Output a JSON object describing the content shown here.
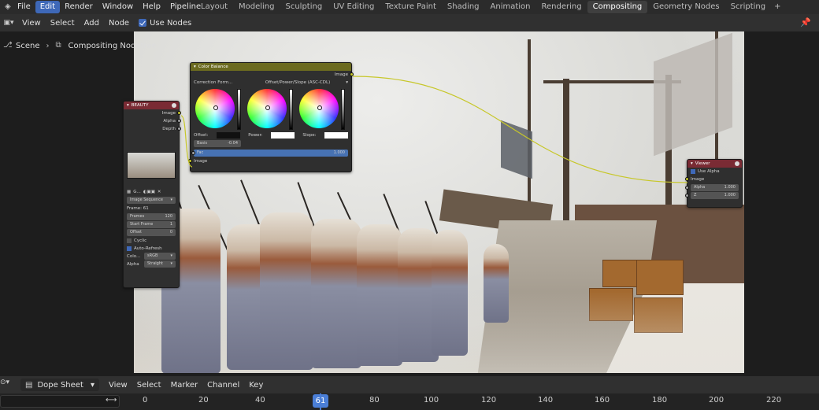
{
  "menu": [
    "File",
    "Edit",
    "Render",
    "Window",
    "Help",
    "Pipeline"
  ],
  "menu_active": "Edit",
  "workspaces": [
    "Layout",
    "Modeling",
    "Sculpting",
    "UV Editing",
    "Texture Paint",
    "Shading",
    "Animation",
    "Rendering",
    "Compositing",
    "Geometry Nodes",
    "Scripting"
  ],
  "workspace_active": "Compositing",
  "workspace_add": "+",
  "editor_header": {
    "items": [
      "View",
      "Select",
      "Add",
      "Node"
    ],
    "use_nodes_label": "Use Nodes",
    "use_nodes": true
  },
  "breadcrumb": {
    "scene": "Scene",
    "tree": "Compositing Nodetree"
  },
  "render_layers_node": {
    "title": "BEAUTY",
    "outputs": [
      "Image",
      "Alpha",
      "Depth"
    ],
    "file_label": "G...",
    "source": "Image Sequence",
    "frame_label": "Frame: 61",
    "fields": [
      {
        "label": "Frames",
        "value": "120"
      },
      {
        "label": "Start Frame",
        "value": "1"
      },
      {
        "label": "Offset",
        "value": "0"
      }
    ],
    "cyclic_label": "Cyclic",
    "auto_refresh_label": "Auto-Refresh",
    "colorspace_label": "Colo...",
    "colorspace_value": "sRGB",
    "alpha_label": "Alpha",
    "alpha_value": "Straight"
  },
  "color_balance_node": {
    "title": "Color Balance",
    "output": "Image",
    "correction_label": "Correction Form...",
    "correction_value": "Offset/Power/Slope (ASC-CDL)",
    "offset_label": "Offset:",
    "power_label": "Power:",
    "slope_label": "Slope:",
    "basis_label": "Basis",
    "basis_value": "-0.04",
    "fac_label": "Fac",
    "fac_value": "1.000",
    "input": "Image"
  },
  "viewer_node": {
    "title": "Viewer",
    "use_alpha_label": "Use Alpha",
    "input": "Image",
    "alpha_label": "Alpha",
    "alpha_value": "1.000",
    "z_label": "Z",
    "z_value": "1.000"
  },
  "dope_sheet": {
    "mode": "Dope Sheet",
    "items": [
      "View",
      "Select",
      "Marker",
      "Channel",
      "Key"
    ]
  },
  "timeline": {
    "ticks": [
      "0",
      "20",
      "40",
      "60",
      "80",
      "100",
      "120",
      "140",
      "160",
      "180",
      "200",
      "220"
    ],
    "current_frame": "61"
  },
  "colors": {
    "accent": "#3e68b8",
    "color_balance_header": "#6b6a1f",
    "render_layers_header": "#7a2b34",
    "viewer_header": "#7a2b34"
  }
}
